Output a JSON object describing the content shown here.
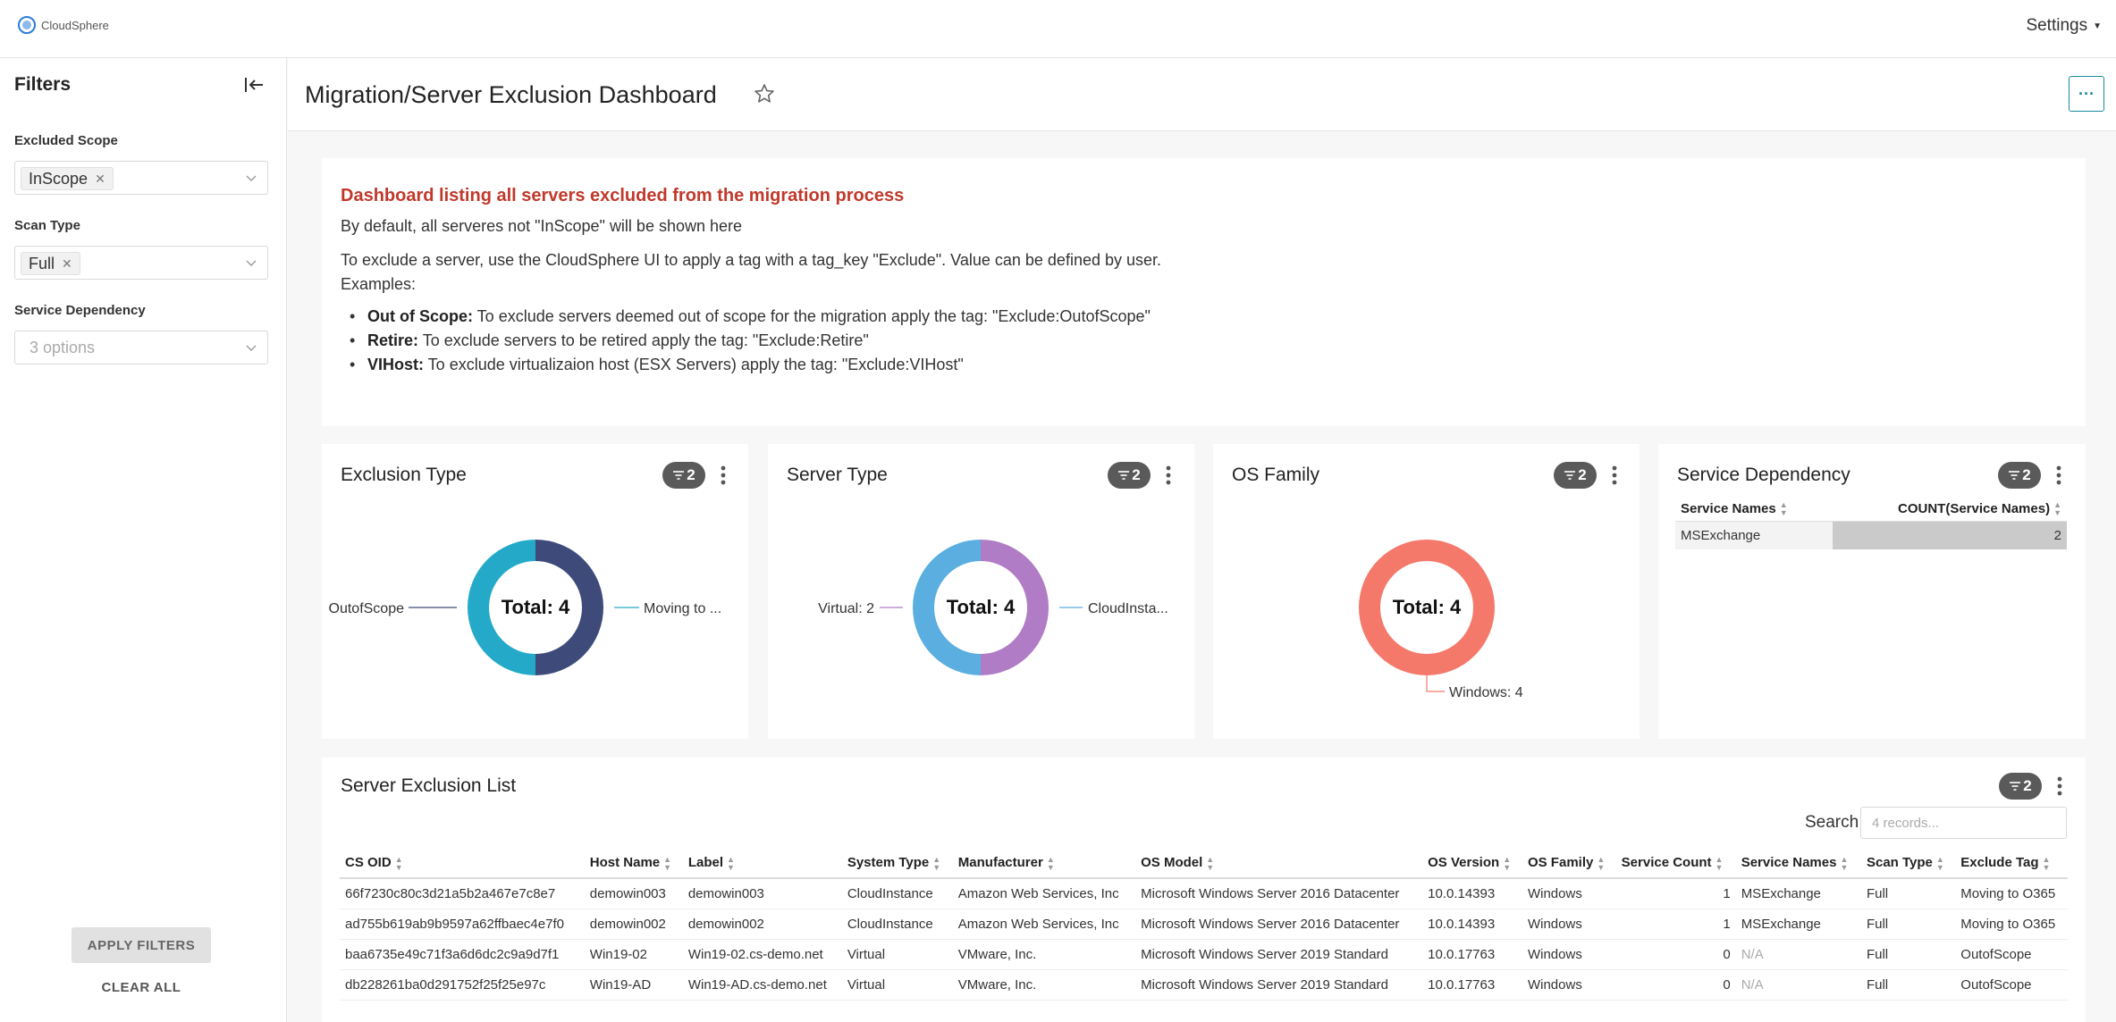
{
  "app": {
    "logo_text": "CloudSphere",
    "settings_label": "Settings"
  },
  "sidebar": {
    "title": "Filters",
    "filters": [
      {
        "label": "Excluded Scope",
        "tag": "InScope"
      },
      {
        "label": "Scan Type",
        "tag": "Full"
      },
      {
        "label": "Service Dependency",
        "placeholder": "3 options"
      }
    ],
    "apply_label": "APPLY FILTERS",
    "clear_label": "CLEAR ALL"
  },
  "header": {
    "title": "Migration/Server Exclusion Dashboard",
    "more_label": "···"
  },
  "markdown": {
    "heading": "Dashboard listing all servers excluded from the migration process",
    "line1": "By default, all serveres not \"InScope\" will be shown here",
    "line2": "To exclude a server, use the CloudSphere UI to apply a tag with a tag_key \"Exclude\". Value can be defined by user.",
    "line3": "Examples:",
    "items": [
      {
        "term": "Out of Scope:",
        "text": " To exclude servers deemed out of scope for the migration apply the tag: \"Exclude:OutofScope\""
      },
      {
        "term": "Retire:",
        "text": " To exclude servers to be retired apply the tag: \"Exclude:Retire\""
      },
      {
        "term": "VIHost:",
        "text": " To exclude virtualizaion host (ESX Servers) apply the tag: \"Exclude:VIHost\""
      }
    ]
  },
  "charts": {
    "exclusion_type": {
      "title": "Exclusion Type",
      "badge": "2",
      "center": "Total: 4",
      "label_left": "OutofScope",
      "label_right": "Moving to ..."
    },
    "server_type": {
      "title": "Server Type",
      "badge": "2",
      "center": "Total: 4",
      "label_left": "Virtual: 2",
      "label_right": "CloudInsta..."
    },
    "os_family": {
      "title": "OS Family",
      "badge": "2",
      "center": "Total: 4",
      "label_bottom": "Windows: 4"
    },
    "service_dependency": {
      "title": "Service Dependency",
      "badge": "2",
      "col1": "Service Names",
      "col2": "COUNT(Service Names)",
      "row_name": "MSExchange",
      "row_value": "2"
    }
  },
  "chart_data": [
    {
      "type": "pie",
      "title": "Exclusion Type",
      "center_label": "Total: 4",
      "categories": [
        "OutofScope",
        "Moving to ..."
      ],
      "values": [
        2,
        2
      ],
      "colors": [
        "#3d4a7a",
        "#24aac8"
      ]
    },
    {
      "type": "pie",
      "title": "Server Type",
      "center_label": "Total: 4",
      "categories": [
        "Virtual: 2",
        "CloudInsta..."
      ],
      "values": [
        2,
        2
      ],
      "colors": [
        "#b07cc6",
        "#5aaee0"
      ]
    },
    {
      "type": "pie",
      "title": "OS Family",
      "center_label": "Total: 4",
      "categories": [
        "Windows: 4"
      ],
      "values": [
        4
      ],
      "colors": [
        "#f4796b"
      ]
    },
    {
      "type": "table",
      "title": "Service Dependency",
      "columns": [
        "Service Names",
        "COUNT(Service Names)"
      ],
      "rows": [
        [
          "MSExchange",
          2
        ]
      ]
    }
  ],
  "list": {
    "title": "Server Exclusion List",
    "badge": "2",
    "search_label": "Search",
    "search_placeholder": "4 records...",
    "columns": [
      "CS OID",
      "Host Name",
      "Label",
      "System Type",
      "Manufacturer",
      "OS Model",
      "OS Version",
      "OS Family",
      "Service Count",
      "Service Names",
      "Scan Type",
      "Exclude Tag"
    ],
    "rows": [
      [
        "66f7230c80c3d21a5b2a467e7c8e7",
        "demowin003",
        "demowin003",
        "CloudInstance",
        "Amazon Web Services, Inc",
        "Microsoft Windows Server 2016 Datacenter",
        "10.0.14393",
        "Windows",
        "1",
        "MSExchange",
        "Full",
        "Moving to O365"
      ],
      [
        "ad755b619ab9b9597a62ffbaec4e7f0",
        "demowin002",
        "demowin002",
        "CloudInstance",
        "Amazon Web Services, Inc",
        "Microsoft Windows Server 2016 Datacenter",
        "10.0.14393",
        "Windows",
        "1",
        "MSExchange",
        "Full",
        "Moving to O365"
      ],
      [
        "baa6735e49c71f3a6d6dc2c9a9d7f1",
        "Win19-02",
        "Win19-02.cs-demo.net",
        "Virtual",
        "VMware, Inc.",
        "Microsoft Windows Server 2019 Standard",
        "10.0.17763",
        "Windows",
        "0",
        "N/A",
        "Full",
        "OutofScope"
      ],
      [
        "db228261ba0d291752f25f25e97c",
        "Win19-AD",
        "Win19-AD.cs-demo.net",
        "Virtual",
        "VMware, Inc.",
        "Microsoft Windows Server 2019 Standard",
        "10.0.17763",
        "Windows",
        "0",
        "N/A",
        "Full",
        "OutofScope"
      ]
    ]
  },
  "colors": {
    "accent": "#1a8a9e",
    "heading_red": "#c0392b",
    "badge": "#5a5a5a"
  },
  "icons": [
    "cloudsphere-logo-icon",
    "collapse-sidebar-icon",
    "chevron-down-icon",
    "star-icon",
    "filter-icon",
    "kebab-menu-icon",
    "sort-icon"
  ]
}
